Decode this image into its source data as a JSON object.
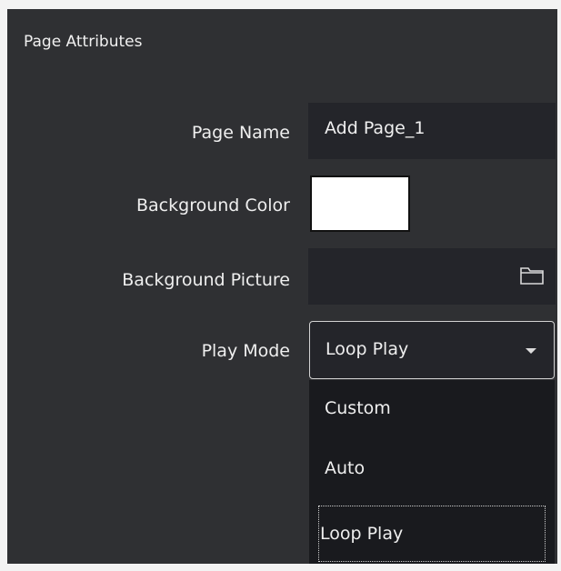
{
  "panel": {
    "title": "Page Attributes"
  },
  "fields": {
    "page_name": {
      "label": "Page Name",
      "value": "Add Page_1"
    },
    "background_color": {
      "label": "Background Color",
      "value": "#ffffff"
    },
    "background_picture": {
      "label": "Background Picture",
      "value": "",
      "icon": "folder-icon"
    },
    "play_mode": {
      "label": "Play Mode",
      "value": "Loop Play",
      "icon": "chevron-down-icon"
    }
  },
  "dropdown": {
    "options": [
      {
        "label": "Custom"
      },
      {
        "label": "Auto"
      },
      {
        "label": "Loop Play"
      }
    ],
    "focused_option": "Loop Play"
  },
  "colors": {
    "panel_bg": "#2f3033",
    "field_bg": "#24252a",
    "dropdown_bg": "#191a1e",
    "text": "#efefef"
  }
}
